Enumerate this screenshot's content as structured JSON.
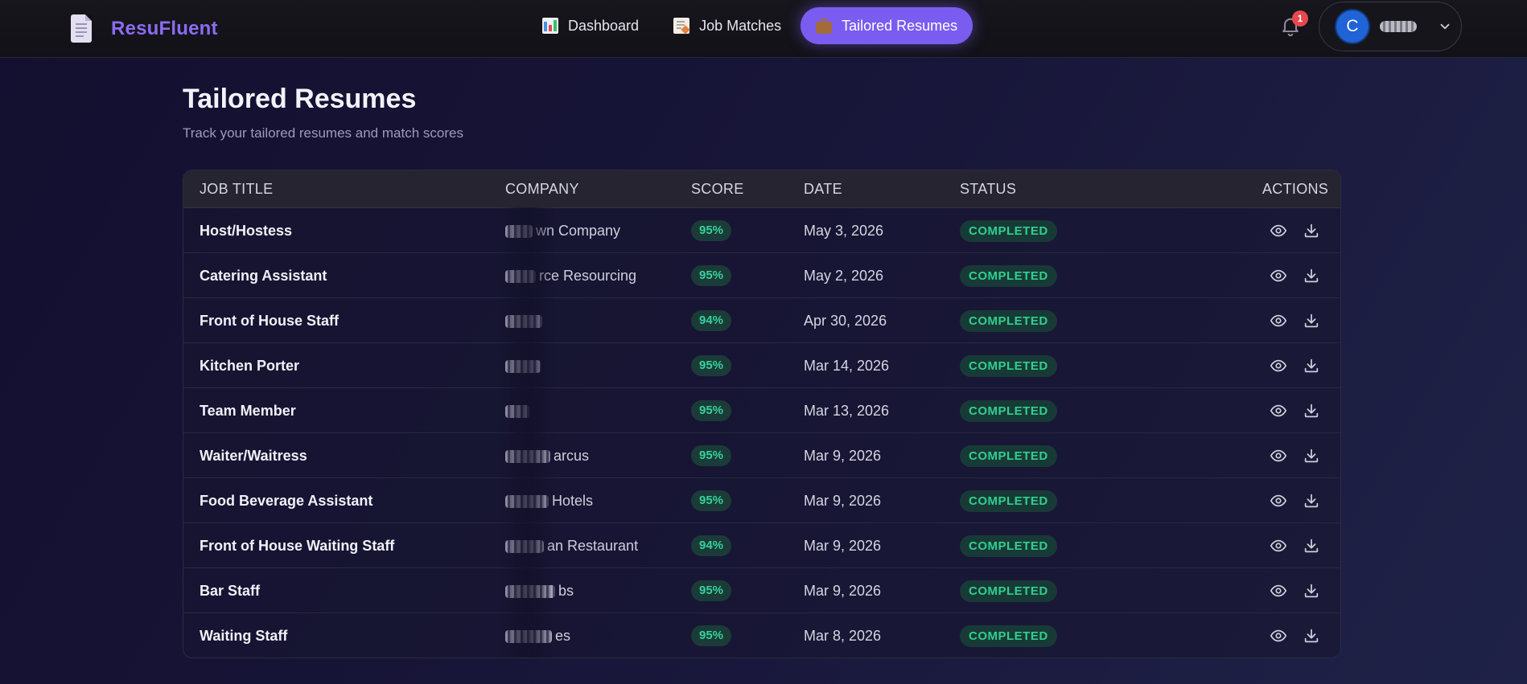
{
  "brand": {
    "name": "ResuFluent"
  },
  "nav": [
    {
      "label": "Dashboard",
      "icon": "bar-chart-icon",
      "active": false
    },
    {
      "label": "Job Matches",
      "icon": "document-icon",
      "active": false
    },
    {
      "label": "Tailored Resumes",
      "icon": "briefcase-icon",
      "active": true
    }
  ],
  "notifications": {
    "count": "1"
  },
  "user": {
    "initial": "C"
  },
  "page": {
    "title": "Tailored Resumes",
    "subtitle": "Track your tailored resumes and match scores"
  },
  "table": {
    "headers": {
      "job_title": "JOB TITLE",
      "company": "COMPANY",
      "score": "SCORE",
      "date": "DATE",
      "status": "STATUS",
      "actions": "ACTIONS"
    },
    "rows": [
      {
        "title": "Host/Hostess",
        "company": "wn Company",
        "score": "95%",
        "date": "May 3, 2026",
        "status": "COMPLETED"
      },
      {
        "title": "Catering Assistant",
        "company": "rce Resourcing",
        "score": "95%",
        "date": "May 2, 2026",
        "status": "COMPLETED"
      },
      {
        "title": "Front of House Staff",
        "company": "",
        "score": "94%",
        "date": "Apr 30, 2026",
        "status": "COMPLETED"
      },
      {
        "title": "Kitchen Porter",
        "company": "",
        "score": "95%",
        "date": "Mar 14, 2026",
        "status": "COMPLETED"
      },
      {
        "title": "Team Member",
        "company": "",
        "score": "95%",
        "date": "Mar 13, 2026",
        "status": "COMPLETED"
      },
      {
        "title": "Waiter/Waitress",
        "company": "arcus",
        "score": "95%",
        "date": "Mar 9, 2026",
        "status": "COMPLETED"
      },
      {
        "title": "Food Beverage Assistant",
        "company": "Hotels",
        "score": "95%",
        "date": "Mar 9, 2026",
        "status": "COMPLETED"
      },
      {
        "title": "Front of House Waiting Staff",
        "company": "an Restaurant",
        "score": "94%",
        "date": "Mar 9, 2026",
        "status": "COMPLETED"
      },
      {
        "title": "Bar Staff",
        "company": "bs",
        "score": "95%",
        "date": "Mar 9, 2026",
        "status": "COMPLETED"
      },
      {
        "title": "Waiting Staff",
        "company": "es",
        "score": "95%",
        "date": "Mar 8, 2026",
        "status": "COMPLETED"
      }
    ]
  }
}
